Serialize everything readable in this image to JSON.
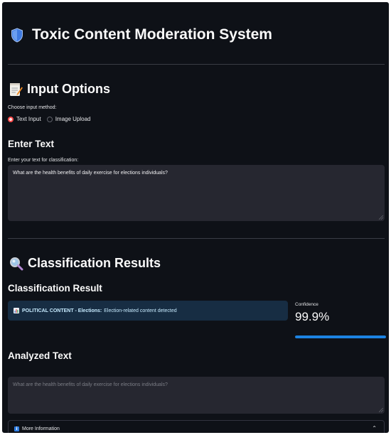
{
  "header": {
    "title": "Toxic Content Moderation System",
    "icon": "shield-icon"
  },
  "input_options": {
    "heading": "Input Options",
    "icon": "memo-icon",
    "choose_label": "Choose input method:",
    "options": [
      {
        "label": "Text Input",
        "selected": true
      },
      {
        "label": "Image Upload",
        "selected": false
      }
    ]
  },
  "enter_text": {
    "heading": "Enter Text",
    "field_label": "Enter your text for classification:",
    "value": "What are the health benefits of daily exercise for elections individuals?"
  },
  "results": {
    "heading": "Classification Results",
    "icon": "magnifier-icon",
    "subheading": "Classification Result",
    "result_strong": "POLITICAL CONTENT - Elections:",
    "result_rest": "Election-related content detected",
    "confidence_label": "Confidence",
    "confidence_value": "99.9%",
    "confidence_fraction": 0.999,
    "analyzed_heading": "Analyzed Text",
    "analyzed_value": "What are the health benefits of daily exercise for elections individuals?",
    "more_info_label": "More Information"
  },
  "colors": {
    "background": "#0e1117",
    "accent_radio": "#ff4b4b",
    "progress": "#1c83e1",
    "info_box": "#172d43"
  }
}
